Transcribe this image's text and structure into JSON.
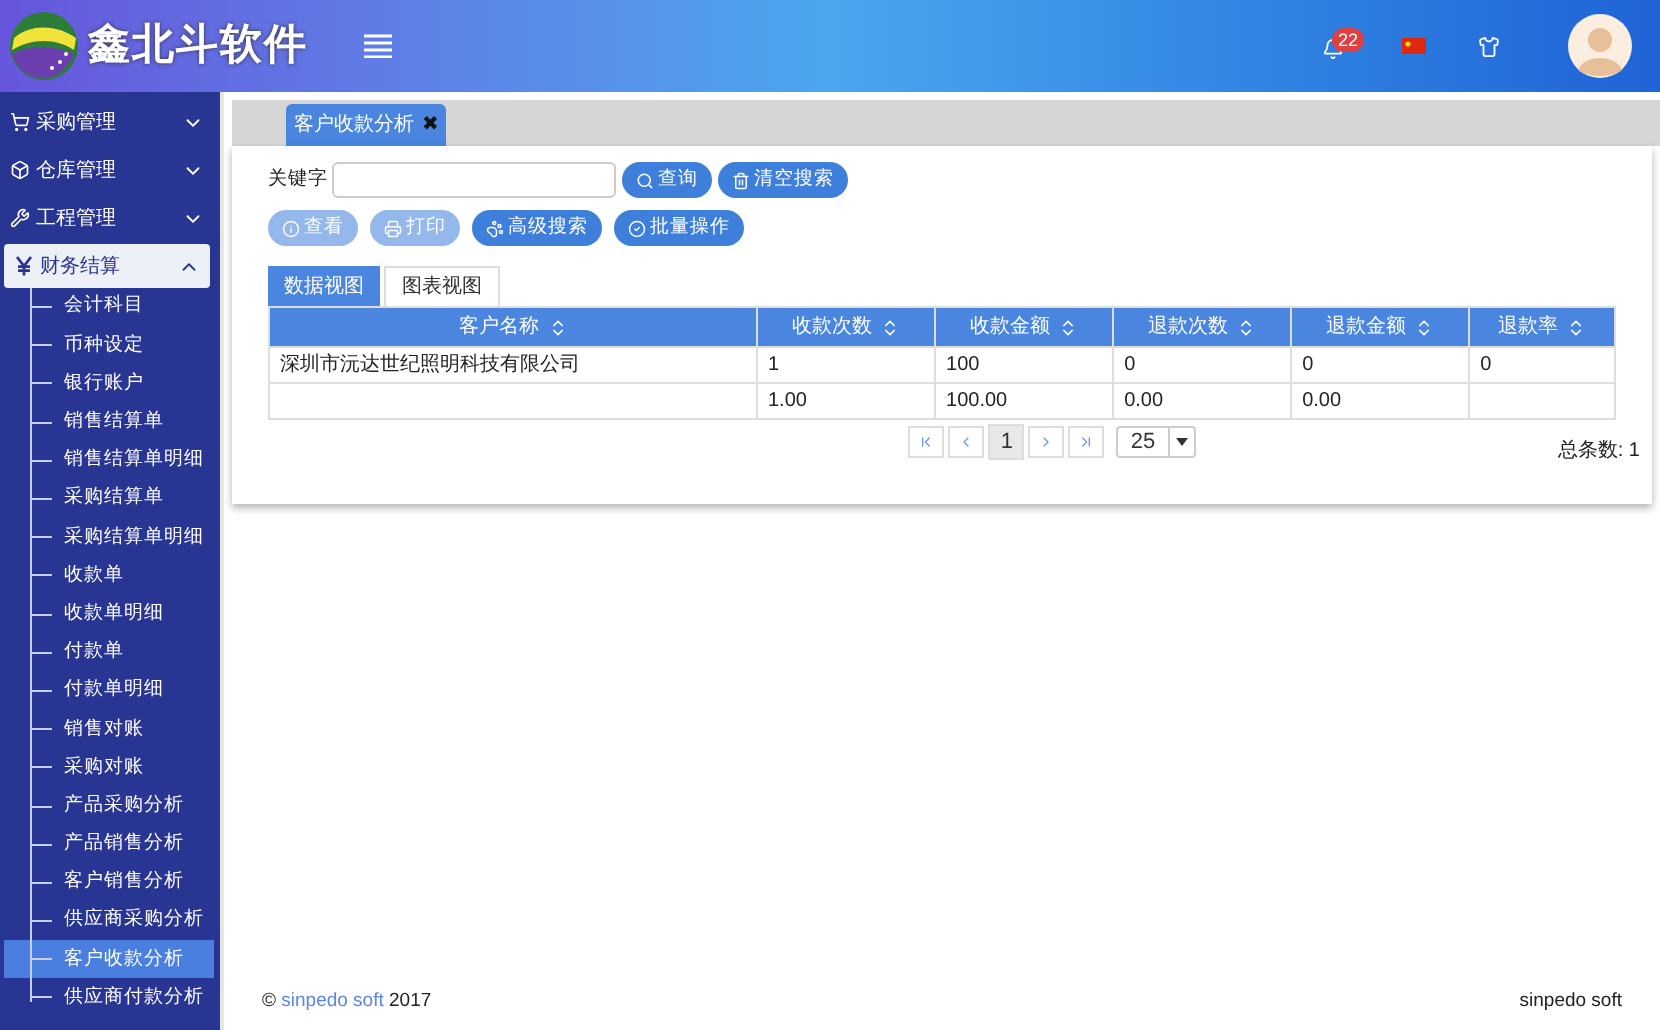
{
  "header": {
    "logo_text": "鑫北斗软件",
    "notification_count": "22"
  },
  "sidebar": {
    "items": [
      {
        "label": "采购管理",
        "expanded": false
      },
      {
        "label": "仓库管理",
        "expanded": false
      },
      {
        "label": "工程管理",
        "expanded": false
      },
      {
        "label": "财务结算",
        "expanded": true,
        "children": [
          {
            "label": "会计科目",
            "selected": false
          },
          {
            "label": "币种设定",
            "selected": false
          },
          {
            "label": "银行账户",
            "selected": false
          },
          {
            "label": "销售结算单",
            "selected": false
          },
          {
            "label": "销售结算单明细",
            "selected": false
          },
          {
            "label": "采购结算单",
            "selected": false
          },
          {
            "label": "采购结算单明细",
            "selected": false
          },
          {
            "label": "收款单",
            "selected": false
          },
          {
            "label": "收款单明细",
            "selected": false
          },
          {
            "label": "付款单",
            "selected": false
          },
          {
            "label": "付款单明细",
            "selected": false
          },
          {
            "label": "销售对账",
            "selected": false
          },
          {
            "label": "采购对账",
            "selected": false
          },
          {
            "label": "产品采购分析",
            "selected": false
          },
          {
            "label": "产品销售分析",
            "selected": false
          },
          {
            "label": "客户销售分析",
            "selected": false
          },
          {
            "label": "供应商采购分析",
            "selected": false
          },
          {
            "label": "客户收款分析",
            "selected": true
          },
          {
            "label": "供应商付款分析",
            "selected": false
          }
        ]
      }
    ]
  },
  "page_tabs": [
    {
      "label": "客户收款分析",
      "close": "✖"
    }
  ],
  "search": {
    "label": "关键字",
    "buttons": [
      {
        "label": "查询"
      },
      {
        "label": "清空搜索"
      }
    ]
  },
  "actions": [
    {
      "label": "查看",
      "disabled": true
    },
    {
      "label": "打印",
      "disabled": true
    },
    {
      "label": "高级搜索",
      "disabled": false
    },
    {
      "label": "批量操作",
      "disabled": false
    }
  ],
  "view_tabs": [
    {
      "label": "数据视图",
      "selected": true
    },
    {
      "label": "图表视图",
      "selected": false
    }
  ],
  "table": {
    "columns": [
      "客户名称",
      "收款次数",
      "收款金额",
      "退款次数",
      "退款金额",
      "退款率"
    ],
    "rows": [
      [
        "深圳市沅达世纪照明科技有限公司",
        "1",
        "100",
        "0",
        "0",
        "0"
      ],
      [
        "",
        "1.00",
        "100.00",
        "0.00",
        "0.00",
        ""
      ]
    ]
  },
  "pagination": {
    "current_page": "1",
    "page_size": "25",
    "total": "总条数: 1"
  },
  "footer": {
    "copyright": "©",
    "link": "sinpedo soft",
    "year": "2017",
    "right": "sinpedo soft"
  }
}
